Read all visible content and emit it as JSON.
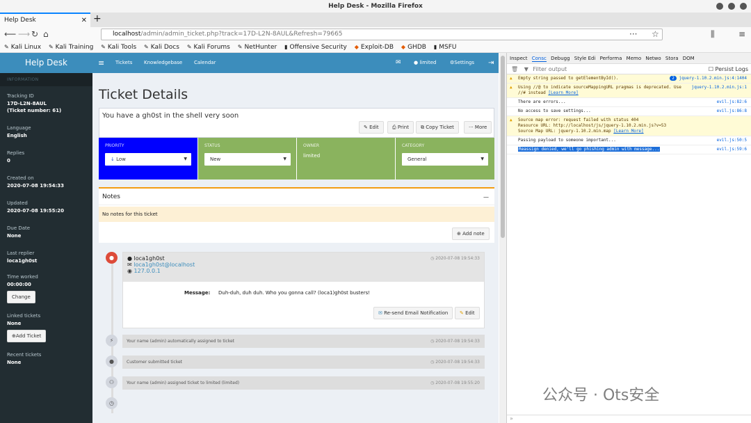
{
  "window": {
    "title": "Help Desk - Mozilla Firefox"
  },
  "tab": {
    "title": "Help Desk",
    "close": "✕",
    "new_tab": "+"
  },
  "url": {
    "host": "localhost",
    "path": "/admin/admin_ticket.php?track=17D-L2N-8AUL&Refresh=79665"
  },
  "bookmarks": [
    "Kali Linux",
    "Kali Training",
    "Kali Tools",
    "Kali Docs",
    "Kali Forums",
    "NetHunter",
    "Offensive Security",
    "Exploit-DB",
    "GHDB",
    "MSFU"
  ],
  "sidebar": {
    "brand": "Help Desk",
    "header": "INFORMATION",
    "tracking_label": "Tracking ID",
    "tracking_id": "17D-L2N-8AUL",
    "ticket_number": "(Ticket number: 61)",
    "language_label": "Language",
    "language": "English",
    "replies_label": "Replies",
    "replies": "0",
    "created_label": "Created on",
    "created": "2020-07-08 19:54:33",
    "updated_label": "Updated",
    "updated": "2020-07-08 19:55:20",
    "due_label": "Due Date",
    "due": "None",
    "replier_label": "Last replier",
    "replier": "loca1gh0st",
    "time_label": "Time worked",
    "time": "00:00:00",
    "change_btn": "Change",
    "linked_label": "Linked tickets",
    "linked": "None",
    "add_ticket_btn": "Add Ticket",
    "recent_label": "Recent tickets",
    "recent": "None"
  },
  "topnav": {
    "menu_icon": "≡",
    "tickets": "Tickets",
    "kb": "Knowledgebase",
    "calendar": "Calendar",
    "mail_icon": "✉",
    "user": "limited",
    "settings": "Settings",
    "logout_icon": "⇥"
  },
  "page": {
    "title": "Ticket Details",
    "subject": "You have a gh0st in the shell very soon"
  },
  "actions": {
    "edit": "Edit",
    "print": "Print",
    "copy": "Copy Ticket",
    "more": "More"
  },
  "fields": {
    "priority_label": "PRIORITY",
    "priority": "Low",
    "status_label": "STATUS",
    "status": "New",
    "owner_label": "OWNER",
    "owner": "limited",
    "category_label": "CATEGORY",
    "category": "General"
  },
  "colors": {
    "priority": "#0000ff",
    "green": "#8ab35e",
    "accent": "#3c8dbc"
  },
  "notes": {
    "title": "Notes",
    "collapse": "—",
    "empty": "No notes for this ticket",
    "add_btn": "Add note"
  },
  "message": {
    "name": "loca1gh0st",
    "email": "loca1gh0st@localhost",
    "ip": "127.0.0.1",
    "time": "2020-07-08 19:54:33",
    "label": "Message:",
    "body": "Duh-duh, duh duh. Who you gonna call? (loca1)gh0st busters!",
    "resend_btn": "Re-send Email Notification",
    "edit_btn": "Edit"
  },
  "events": [
    {
      "text": "Your name (admin) automatically assigned to ticket",
      "time": "2020-07-08 19:54:33"
    },
    {
      "text": "Customer submitted ticket",
      "time": "2020-07-08 19:54:33"
    },
    {
      "text": "Your name (admin) assigned ticket to limited (limited)",
      "time": "2020-07-08 19:55:20"
    }
  ],
  "devtools": {
    "tabs": [
      "Inspect",
      "Consc",
      "Debugg",
      "Style Edi",
      "Performa",
      "Memo",
      "Netwo",
      "Stora",
      "DOM"
    ],
    "filter": "Filter output",
    "persist": "Persist Logs",
    "logs": [
      {
        "text": "Empty string passed to getElementById().",
        "src": "jquery-1.10.2.min.js:4:1404",
        "warn": true,
        "badge": "2"
      },
      {
        "text": "Using //@ to indicate sourceMappingURL pragmas is deprecated. Use //# instead",
        "link": "[Learn More]",
        "src": "jquery-1.10.2.min.js:1",
        "warn": true
      },
      {
        "text": "There are errors...",
        "src": "evil.js:82:6",
        "warn": false
      },
      {
        "text": "No access to save settings...",
        "src": "evil.js:86:8",
        "warn": false
      },
      {
        "text": "Source map error: request failed with status 404\nResource URL: http://localhost/js/jquery-1.10.2.min.js?v=53\nSource Map URL: jquery-1.10.2.min.map",
        "link": "[Learn More]",
        "src": "",
        "warn": true
      },
      {
        "text": "Passing payload to someone important...",
        "src": "evil.js:50:5",
        "warn": false
      },
      {
        "text": "Reassign denied, we'll go phishing admin with message...",
        "src": "evil.js:59:6",
        "warn": false,
        "selected": true
      }
    ]
  },
  "watermark": "公众号 · Ots安全"
}
